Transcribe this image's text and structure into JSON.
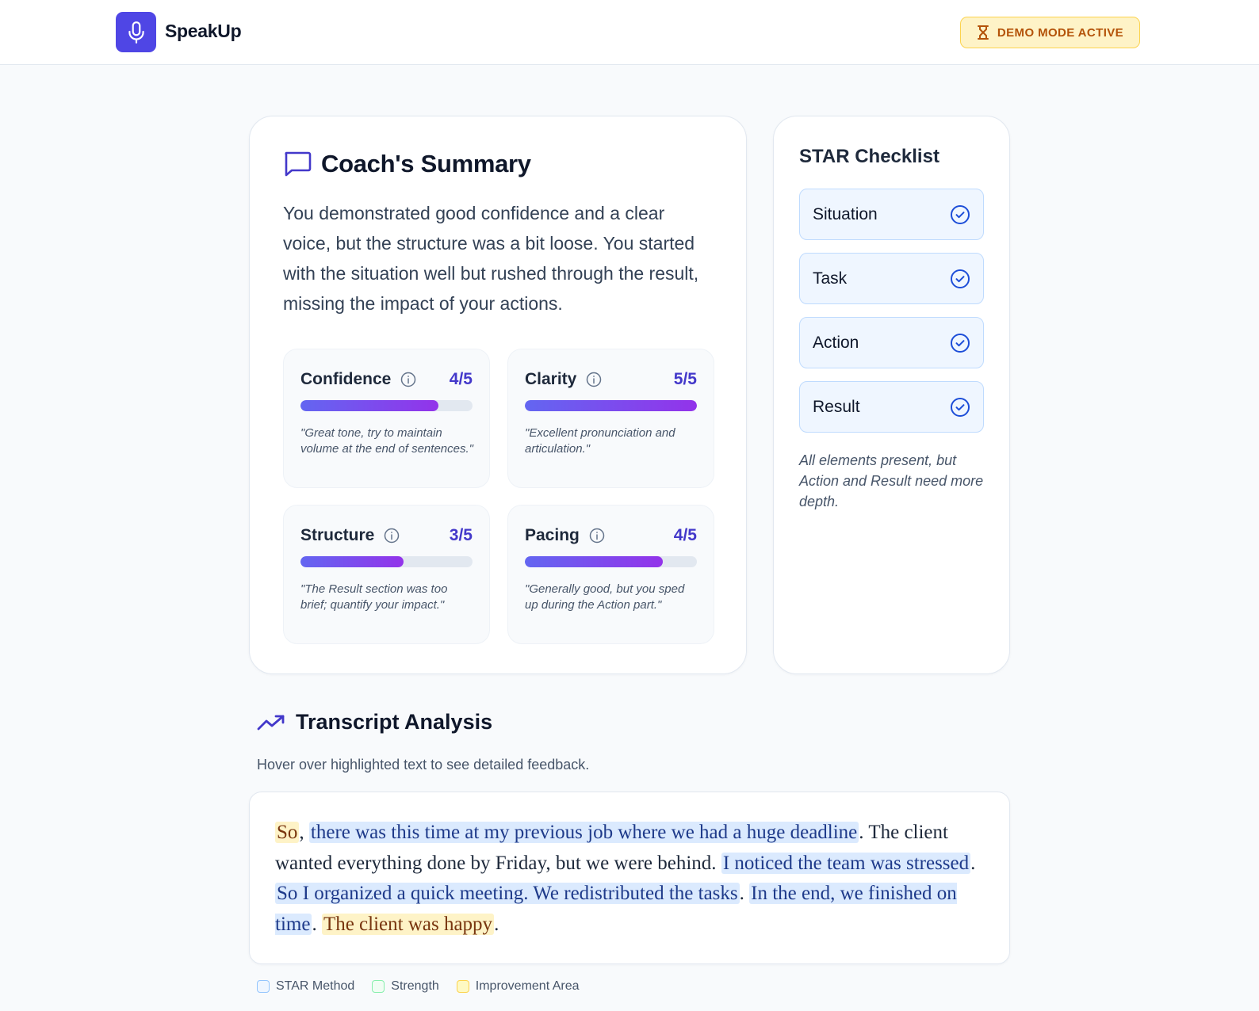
{
  "header": {
    "brand": "SpeakUp",
    "logo_icon": "microphone-icon",
    "demo_badge": "DEMO MODE ACTIVE",
    "demo_icon": "hourglass-icon",
    "brand_color": "#4f46e5"
  },
  "summary": {
    "title": "Coach's Summary",
    "title_icon": "chat-bubble-icon",
    "text": "You demonstrated good confidence and a clear voice, but the structure was a bit loose. You started with the situation well but rushed through the result, missing the impact of your actions."
  },
  "metrics": [
    {
      "name": "Confidence",
      "score": "4/5",
      "fraction": 0.8,
      "quote": "\"Great tone, try to maintain volume at the end of sentences.\""
    },
    {
      "name": "Clarity",
      "score": "5/5",
      "fraction": 1.0,
      "quote": "\"Excellent pronunciation and articulation.\""
    },
    {
      "name": "Structure",
      "score": "3/5",
      "fraction": 0.6,
      "quote": "\"The Result section was too brief; quantify your impact.\""
    },
    {
      "name": "Pacing",
      "score": "4/5",
      "fraction": 0.8,
      "quote": "\"Generally good, but you sped up during the Action part.\""
    }
  ],
  "star": {
    "title": "STAR Checklist",
    "items": [
      {
        "label": "Situation",
        "checked": true
      },
      {
        "label": "Task",
        "checked": true
      },
      {
        "label": "Action",
        "checked": true
      },
      {
        "label": "Result",
        "checked": true
      }
    ],
    "note": "All elements present, but Action and Result need more depth."
  },
  "transcript": {
    "title": "Transcript Analysis",
    "title_icon": "trending-up-icon",
    "hint": "Hover over highlighted text to see detailed feedback.",
    "segments": [
      {
        "text": "So",
        "type": "improvement"
      },
      {
        "text": ", ",
        "type": "plain"
      },
      {
        "text": "there was this time at my previous job where we had a huge deadline",
        "type": "star"
      },
      {
        "text": ". The client wanted everything done by Friday, but we were behind. ",
        "type": "plain"
      },
      {
        "text": "I noticed the team was stressed",
        "type": "star"
      },
      {
        "text": ". ",
        "type": "plain"
      },
      {
        "text": "So I organized a quick meeting. We redistributed the tasks",
        "type": "star"
      },
      {
        "text": ". ",
        "type": "plain"
      },
      {
        "text": "In the end, we finished on time",
        "type": "star"
      },
      {
        "text": ". ",
        "type": "plain"
      },
      {
        "text": "The client was happy",
        "type": "improvement"
      },
      {
        "text": ".",
        "type": "plain"
      }
    ]
  },
  "legend": {
    "star": "STAR Method",
    "strength": "Strength",
    "improvement": "Improvement Area"
  }
}
